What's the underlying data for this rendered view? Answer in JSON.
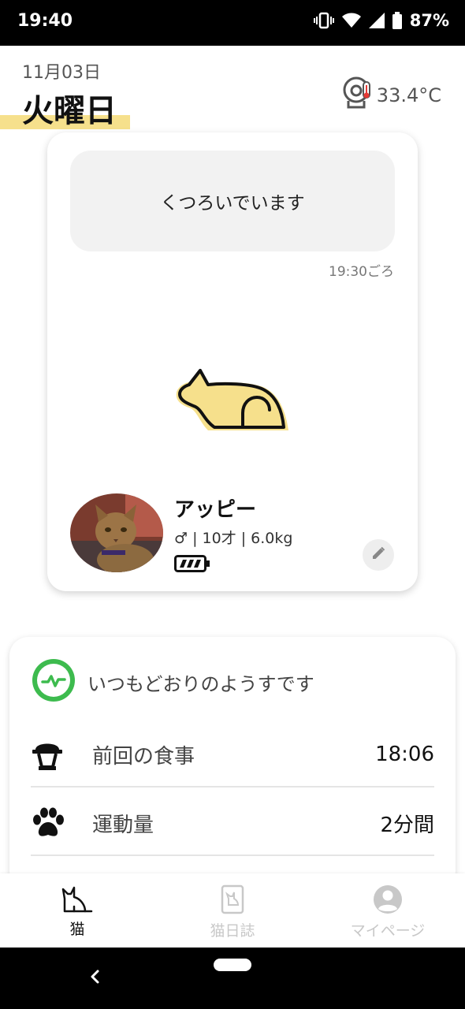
{
  "status_bar": {
    "time": "19:40",
    "battery": "87%"
  },
  "header": {
    "date": "11月03日",
    "weekday": "火曜日",
    "temperature": "33.4°C"
  },
  "main_card": {
    "status_message": "くつろいでいます",
    "status_time": "19:30ごろ",
    "pet": {
      "name": "アッピー",
      "info": "♂ | 10才 | 6.0kg"
    }
  },
  "health_card": {
    "summary": "いつもどおりのようすです",
    "rows": [
      {
        "label": "前回の食事",
        "value": "18:06"
      },
      {
        "label": "運動量",
        "value": "2分間"
      }
    ]
  },
  "bottom_nav": {
    "items": [
      {
        "label": "猫"
      },
      {
        "label": "猫日誌"
      },
      {
        "label": "マイページ"
      }
    ]
  },
  "colors": {
    "accent_yellow": "#f6e08c",
    "health_green": "#3dbb4e"
  }
}
